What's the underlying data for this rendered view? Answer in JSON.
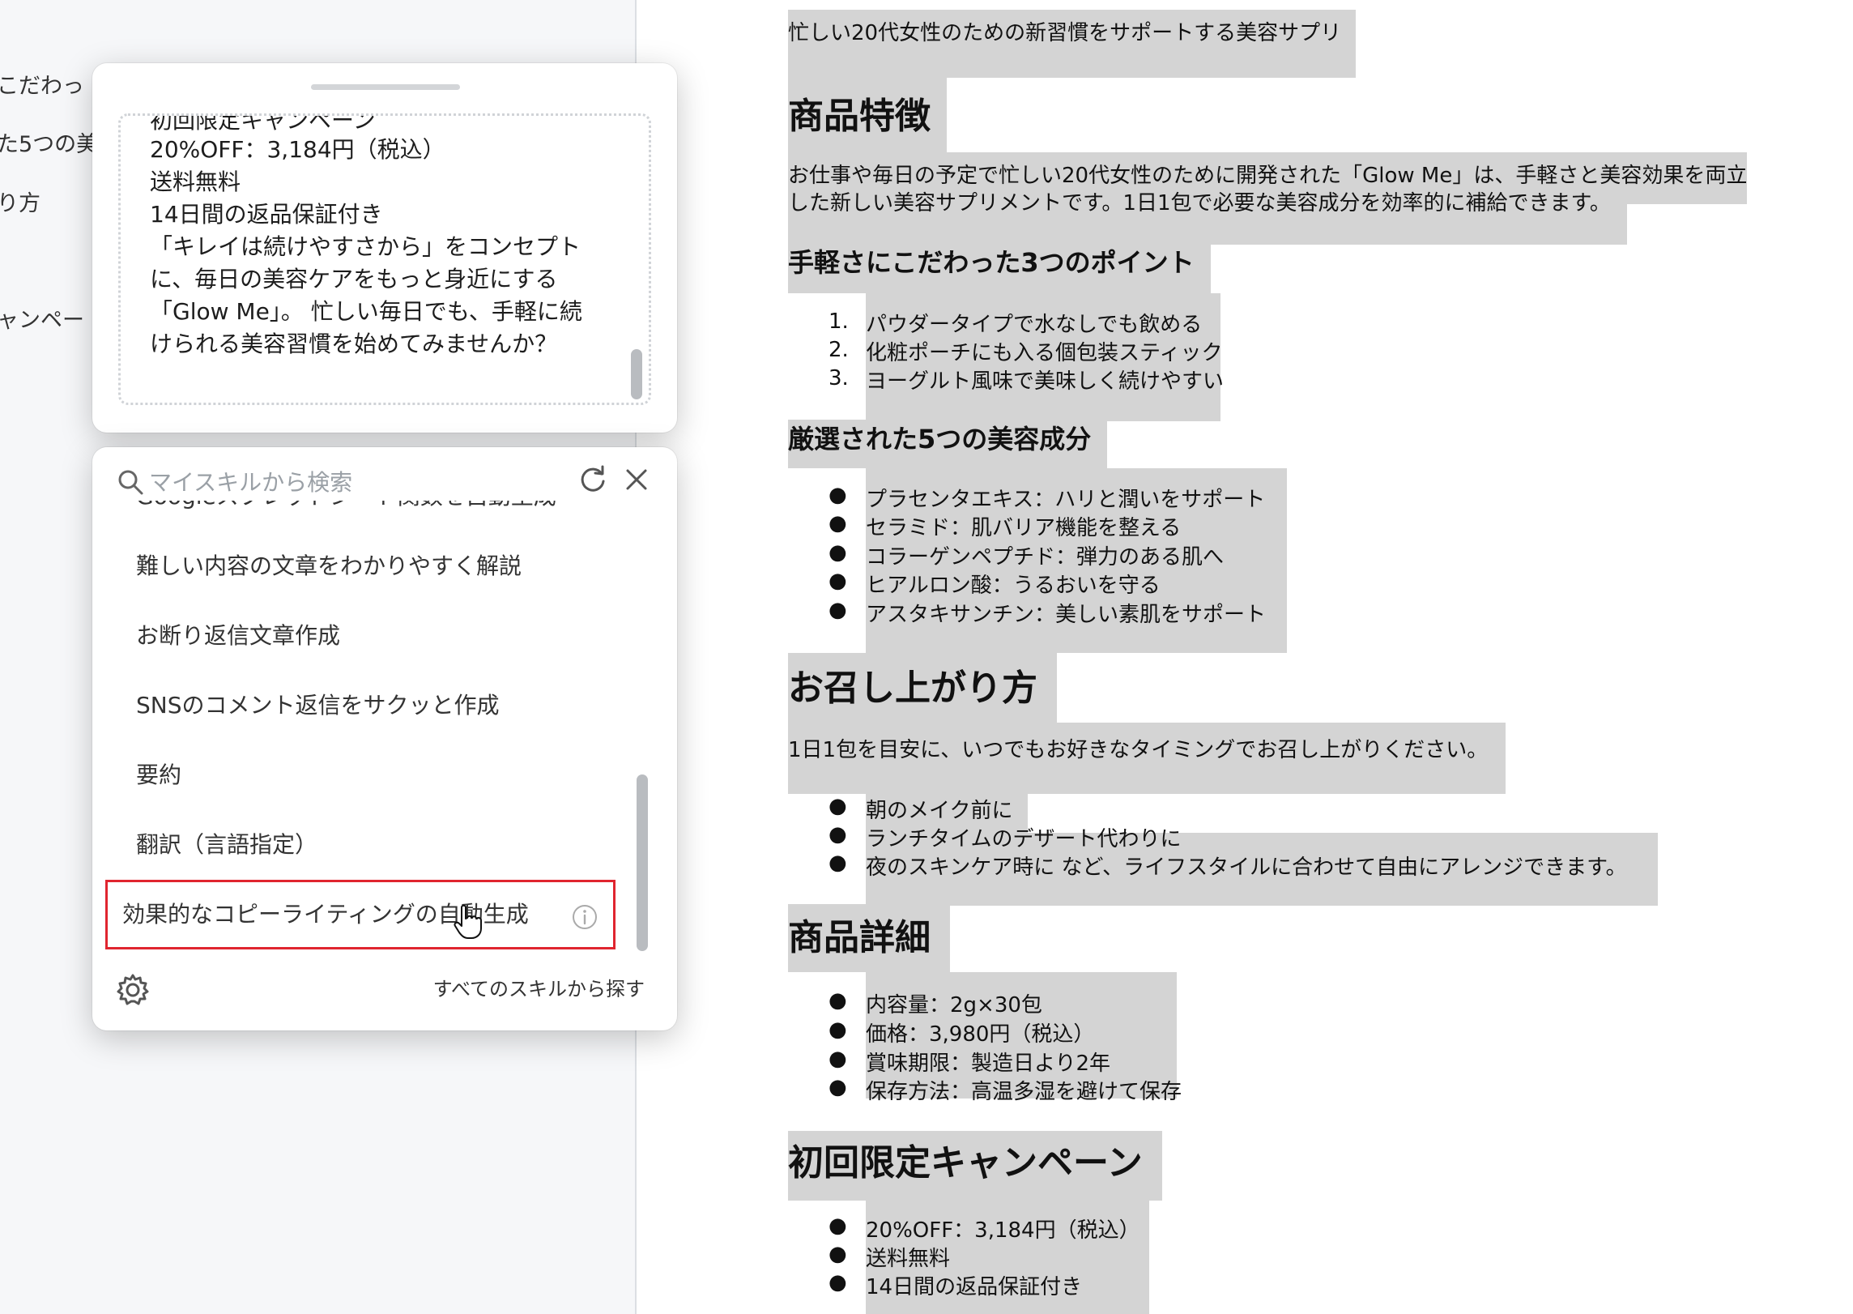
{
  "outline": [
    "こだわっ",
    "た5つの美",
    "り方",
    "ャンペー"
  ],
  "popup": {
    "text_lines": [
      "初回限定キャンペーン",
      "20%OFF：3,184円（税込）",
      "送料無料",
      "14日間の返品保証付き",
      "「キレイは続けやすさから」をコンセプト",
      "に、毎日の美容ケアをもっと身近にする",
      "「Glow Me」。 忙しい毎日でも、手軽に続",
      "けられる美容習慣を始めてみませんか？"
    ]
  },
  "skills": {
    "search_placeholder": "マイスキルから検索",
    "items": [
      "Googleスプレッドシート関数を自動生成",
      "難しい内容の文章をわかりやすく解説",
      "お断り返信文章作成",
      "SNSのコメント返信をサクッと作成",
      "要約",
      "翻訳（言語指定）",
      "効果的なコピーライティングの自動生成"
    ],
    "selected_index": 6,
    "footer_link": "すべてのスキルから探す"
  },
  "document": {
    "intro": "忙しい20代女性のための新習慣をサポートする美容サプリ",
    "features_heading": "商品特徴",
    "features_text": [
      "お仕事や毎日の予定で忙しい20代女性のために開発された「Glow Me」は、手軽さと美容効果を両立",
      "した新しい美容サプリメントです。1日1包で必要な美容成分を効率的に補給できます。"
    ],
    "points_heading": "手軽さにこだわった3つのポイント",
    "points": [
      "パウダータイプで水なしでも飲める",
      "化粧ポーチにも入る個包装スティック",
      "ヨーグルト風味で美味しく続けやすい"
    ],
    "ingredients_heading": "厳選された5つの美容成分",
    "ingredients": [
      "プラセンタエキス：ハリと潤いをサポート",
      "セラミド：肌バリア機能を整える",
      "コラーゲンペプチド：弾力のある肌へ",
      "ヒアルロン酸：うるおいを守る",
      "アスタキサンチン：美しい素肌をサポート"
    ],
    "howto_heading": "お召し上がり方",
    "howto_text": "1日1包を目安に、いつでもお好きなタイミングでお召し上がりください。",
    "howto_items": [
      "朝のメイク前に",
      "ランチタイムのデザート代わりに",
      "夜のスキンケア時に など、ライフスタイルに合わせて自由にアレンジできます。"
    ],
    "details_heading": "商品詳細",
    "details": [
      "内容量：2g×30包",
      "価格：3,980円（税込）",
      "賞味期限：製造日より2年",
      "保存方法：高温多湿を避けて保存"
    ],
    "campaign_heading": "初回限定キャンペーン",
    "campaign": [
      "20%OFF：3,184円（税込）",
      "送料無料",
      "14日間の返品保証付き"
    ]
  }
}
